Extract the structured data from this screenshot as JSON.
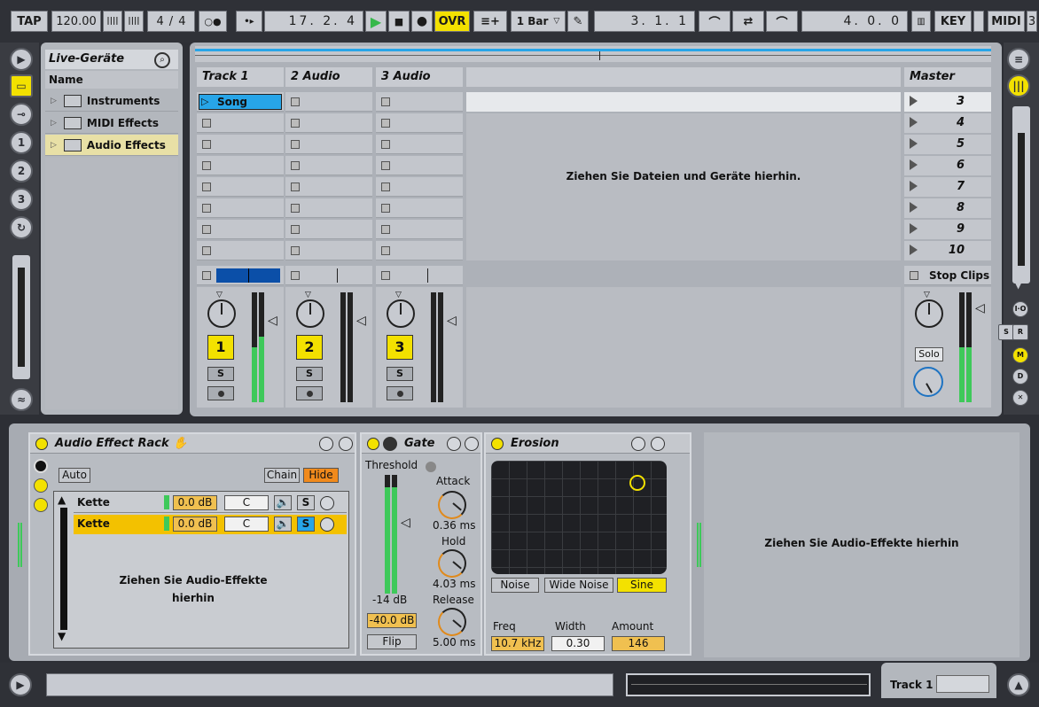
{
  "transport": {
    "tap": "TAP",
    "tempo": "120.00",
    "time_sig_num": "4",
    "time_sig_sep": "/",
    "time_sig_den": "4",
    "position": "17.  2.  4",
    "ovr": "OVR",
    "quantize": "1 Bar",
    "loop_start": "3.  1.  1",
    "loop_length": "4.  0.  0",
    "key": "KEY",
    "midi": "MIDI",
    "midi_num": "3"
  },
  "browser": {
    "title": "Live-Geräte",
    "column": "Name",
    "items": [
      {
        "label": "Instruments"
      },
      {
        "label": "MIDI Effects"
      },
      {
        "label": "Audio Effects"
      }
    ]
  },
  "session": {
    "tracks": [
      "Track 1",
      "2 Audio",
      "3 Audio"
    ],
    "master": "Master",
    "clip_song": "Song",
    "drop_hint": "Ziehen Sie Dateien und Geräte hierhin.",
    "scenes": [
      "3",
      "4",
      "5",
      "6",
      "7",
      "8",
      "9",
      "10"
    ],
    "stop_clips": "Stop Clips",
    "track_numbers": [
      "1",
      "2",
      "3"
    ],
    "solo_label": "S",
    "master_solo": "Solo"
  },
  "rack": {
    "title": "Audio Effect Rack",
    "auto": "Auto",
    "chain": "Chain",
    "hide": "Hide",
    "chains": [
      {
        "name": "Kette",
        "gain": "0.0 dB",
        "pan": "C",
        "solo": "S"
      },
      {
        "name": "Kette",
        "gain": "0.0 dB",
        "pan": "C",
        "solo": "S"
      }
    ],
    "drop_hint_1": "Ziehen Sie Audio-Effekte",
    "drop_hint_2": "hierhin"
  },
  "gate": {
    "title": "Gate",
    "threshold": "Threshold",
    "attack_label": "Attack",
    "attack_value": "0.36 ms",
    "hold_label": "Hold",
    "hold_value": "4.03 ms",
    "release_label": "Release",
    "release_value": "5.00 ms",
    "threshold_value": "-14 dB",
    "return_value": "-40.0 dB",
    "flip": "Flip"
  },
  "erosion": {
    "title": "Erosion",
    "modes": [
      "Noise",
      "Wide Noise",
      "Sine"
    ],
    "freq_label": "Freq",
    "freq_value": "10.7 kHz",
    "width_label": "Width",
    "width_value": "0.30",
    "amount_label": "Amount",
    "amount_value": "146"
  },
  "device_drop_hint": "Ziehen Sie Audio-Effekte hierhin",
  "bottom": {
    "selected_track": "Track 1"
  },
  "colors": {
    "yellow": "#f3e100",
    "orange": "#f08a1c",
    "green": "#3ec95a",
    "clip_blue": "#27a5e8",
    "panel": "#adb1b8"
  }
}
